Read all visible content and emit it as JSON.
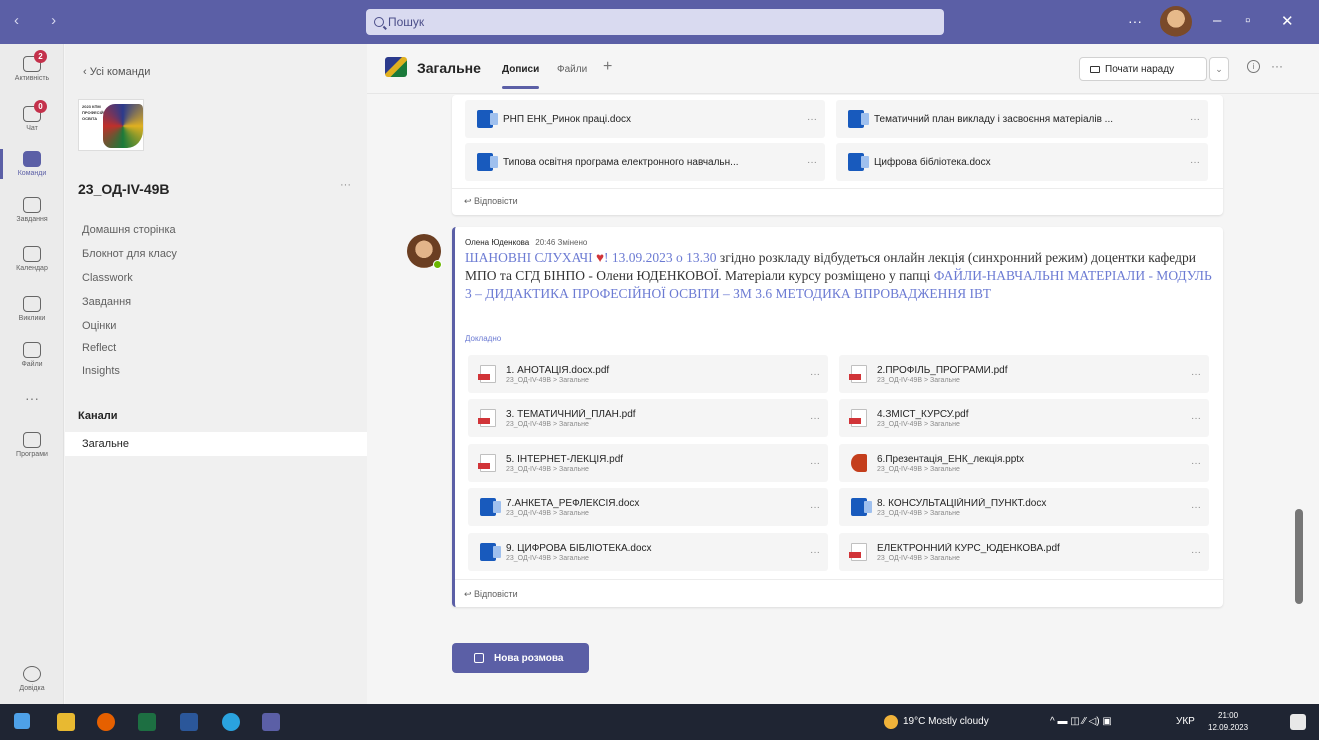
{
  "titlebar": {
    "nav_arrows": "‹ ›",
    "search_placeholder": "Пошук",
    "more": "···",
    "minimize": "–",
    "maximize": "▫",
    "close": "✕"
  },
  "rail": {
    "items": [
      {
        "label": "Активність",
        "icon": "bell-icon",
        "badge": "2"
      },
      {
        "label": "Чат",
        "icon": "chat-icon",
        "badge": "0"
      },
      {
        "label": "Команди",
        "icon": "teams-icon",
        "badge": ""
      },
      {
        "label": "Завдання",
        "icon": "assignments-icon",
        "badge": ""
      },
      {
        "label": "Календар",
        "icon": "calendar-icon",
        "badge": ""
      },
      {
        "label": "Виклики",
        "icon": "phone-icon",
        "badge": ""
      },
      {
        "label": "Файли",
        "icon": "file-icon",
        "badge": ""
      },
      {
        "label": "Програми",
        "icon": "apps-icon",
        "badge": ""
      },
      {
        "label": "Довідка",
        "icon": "help-icon",
        "badge": ""
      }
    ],
    "more": "···"
  },
  "left": {
    "back": "‹  Усі команди",
    "team_name": "23_ОД-IV-49В",
    "team_more": "···",
    "logo_text": "2023 КПМ ПРОФЕСІЙНА ОСВІТА",
    "nav": [
      "Домашня сторінка",
      "Блокнот для класу",
      "Classwork",
      "Завдання",
      "Оцінки",
      "Reflect",
      "Insights"
    ],
    "channels_heading": "Канали",
    "channel": "Загальне"
  },
  "header": {
    "channel": "Загальне",
    "tabs": [
      "Дописи",
      "Файли"
    ],
    "add": "+",
    "meet": "Почати нараду",
    "meet_drop": "⌄",
    "info": "i",
    "more": "···"
  },
  "top_post": {
    "files": [
      {
        "name": "РНП ЕНК_Ринок праці.docx",
        "type": "word"
      },
      {
        "name": "Тематичний план викладу і засвоєння матеріалів ...",
        "type": "word"
      },
      {
        "name": "Типова освітня програма електронного навчальн...",
        "type": "word"
      },
      {
        "name": "Цифрова бібліотека.docx",
        "type": "word"
      }
    ],
    "reply": "↩ Відповісти"
  },
  "post": {
    "author": "Олена Юденкова",
    "time": "20:46  Змінено",
    "greeting": "ШАНОВНІ СЛУХАЧІ",
    "heart": "♥",
    "date": "! 13.09.2023 о 13.30",
    "text1": " згідно розкладу відбудеться онлайн лекція (синхронний режим) доцентки кафедри МПО та СГД БІНПО - Олени ЮДЕНКОВОЇ. Матеріали курсу розміщено у папці ",
    "folder": "ФАЙЛИ-НАВЧАЛЬНІ МАТЕРІАЛИ - МОДУЛЬ 3 – ДИДАКТИКА ПРОФЕСІЙНОЇ ОСВІТИ – ЗМ 3.6 МЕТОДИКА ВПРОВАДЖЕННЯ ІВТ",
    "more_link": "Докладно",
    "files": [
      {
        "name": "1. АНОТАЦІЯ.docx.pdf",
        "sub": "23_ОД-IV-49В > Загальне",
        "type": "pdf"
      },
      {
        "name": "2.ПРОФІЛЬ_ПРОГРАМИ.pdf",
        "sub": "23_ОД-IV-49В > Загальне",
        "type": "pdf"
      },
      {
        "name": "3. ТЕМАТИЧНИЙ_ПЛАН.pdf",
        "sub": "23_ОД-IV-49В > Загальне",
        "type": "pdf"
      },
      {
        "name": "4.ЗМІСТ_КУРСУ.pdf",
        "sub": "23_ОД-IV-49В > Загальне",
        "type": "pdf"
      },
      {
        "name": "5. ІНТЕРНЕТ-ЛЕКЦІЯ.pdf",
        "sub": "23_ОД-IV-49В > Загальне",
        "type": "pdf"
      },
      {
        "name": "6.Презентація_ЕНК_лекція.pptx",
        "sub": "23_ОД-IV-49В > Загальне",
        "type": "ppt"
      },
      {
        "name": "7.АНКЕТА_РЕФЛЕКСІЯ.docx",
        "sub": "23_ОД-IV-49В > Загальне",
        "type": "word"
      },
      {
        "name": "8. КОНСУЛЬТАЦІЙНИЙ_ПУНКТ.docx",
        "sub": "23_ОД-IV-49В > Загальне",
        "type": "word"
      },
      {
        "name": "9. ЦИФРОВА БІБЛІОТЕКА.docx",
        "sub": "23_ОД-IV-49В > Загальне",
        "type": "word"
      },
      {
        "name": "ЕЛЕКТРОННИЙ КУРС_ЮДЕНКОВА.pdf",
        "sub": "23_ОД-IV-49В > Загальне",
        "type": "pdf"
      }
    ],
    "file_more": "···",
    "reply": "↩ Відповісти"
  },
  "new_conversation": "Нова розмова",
  "taskbar": {
    "weather": "19°C  Mostly cloudy",
    "lang": "УКР",
    "time": "21:00",
    "date": "12.09.2023",
    "tray_icons": "^  ▬  ◫  ⁄⁄  ◁)  ▣"
  },
  "colors": {
    "accent": "#5b5fa6",
    "link": "#6c7bd3",
    "badge": "#c4314b",
    "taskbar": "#1f2533"
  }
}
